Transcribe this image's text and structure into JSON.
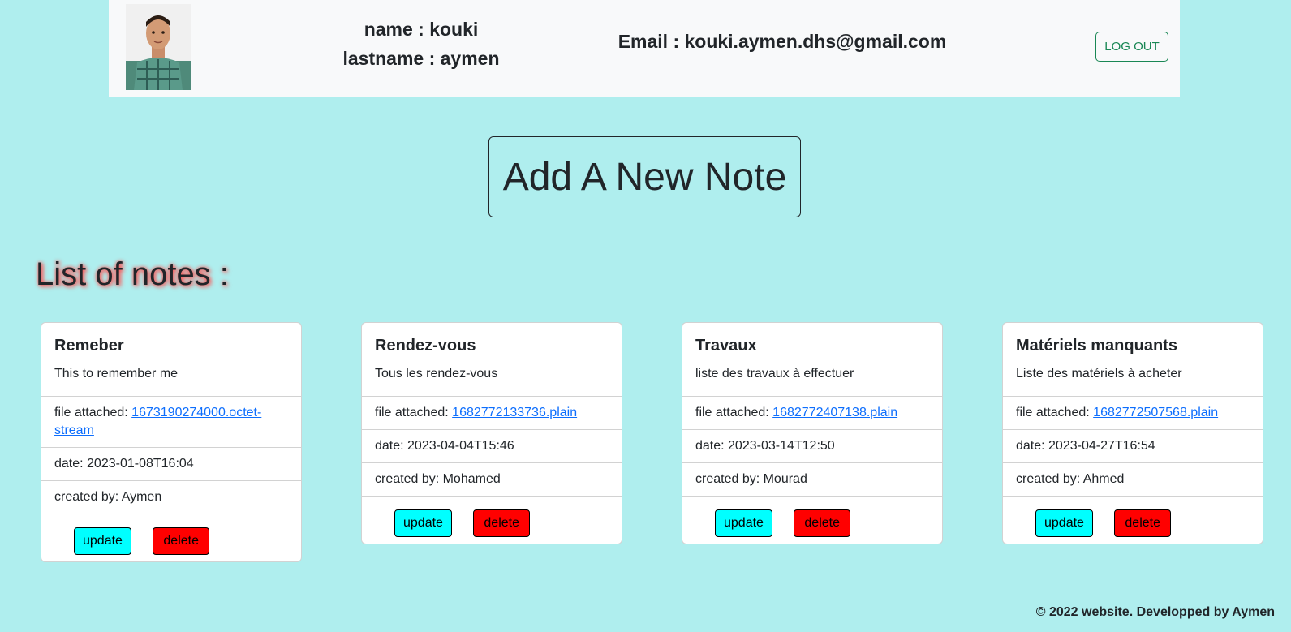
{
  "header": {
    "name_line": "name : kouki",
    "lastname_line": "lastname : aymen",
    "email_line": "Email : kouki.aymen.dhs@gmail.com",
    "logout_label": "LOG OUT"
  },
  "add_note_label": "Add A New Note",
  "list_title": "List of notes :",
  "notes": [
    {
      "title": "Remeber",
      "text": "This to remember me",
      "file_label": "file attached: ",
      "file_link": "1673190274000.octet-stream",
      "date": "date: 2023-01-08T16:04",
      "created_by": "created by: Aymen",
      "update_label": "update",
      "delete_label": "delete"
    },
    {
      "title": "Rendez-vous",
      "text": "Tous les rendez-vous",
      "file_label": "file attached: ",
      "file_link": "1682772133736.plain",
      "date": "date: 2023-04-04T15:46",
      "created_by": "created by: Mohamed",
      "update_label": "update",
      "delete_label": "delete"
    },
    {
      "title": "Travaux",
      "text": "liste des travaux à effectuer",
      "file_label": "file attached: ",
      "file_link": "1682772407138.plain",
      "date": "date: 2023-03-14T12:50",
      "created_by": "created by: Mourad",
      "update_label": "update",
      "delete_label": "delete"
    },
    {
      "title": "Matériels manquants",
      "text": "Liste des matériels à acheter",
      "file_label": "file attached: ",
      "file_link": "1682772507568.plain",
      "date": "date: 2023-04-27T16:54",
      "created_by": "created by: Ahmed",
      "update_label": "update",
      "delete_label": "delete"
    }
  ],
  "footer_text": "© 2022 website. Developped by Aymen",
  "colors": {
    "page_background": "#afeeee",
    "update_button": "#00ffff",
    "delete_button": "#ff0000",
    "logout_outline": "#198754"
  },
  "icons": {
    "avatar": "user-photo"
  }
}
